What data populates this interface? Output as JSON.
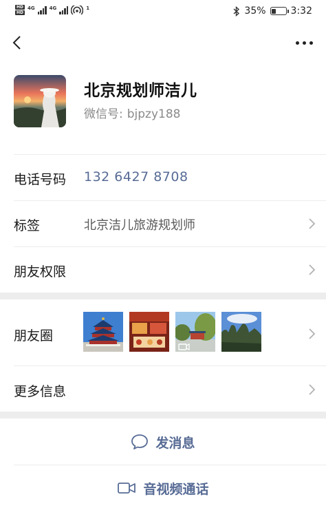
{
  "status_bar": {
    "hd1": "HD",
    "hd2": "HD",
    "net1": "4G",
    "net2": "4G",
    "hotspot_count": "1",
    "battery_percent": "35%",
    "battery_level": 0.35,
    "time": "3:32"
  },
  "profile": {
    "name": "北京规划师洁儿",
    "wechat_id_label": "微信号:",
    "wechat_id": "bjpzy188"
  },
  "rows": {
    "phone": {
      "label": "电话号码",
      "value": "132 6427 8708"
    },
    "tags": {
      "label": "标签",
      "value": "北京洁儿旅游规划师"
    },
    "permissions": {
      "label": "朋友权限"
    },
    "moments": {
      "label": "朋友圈"
    },
    "more_info": {
      "label": "更多信息"
    }
  },
  "actions": {
    "send_message": "发消息",
    "av_call": "音视频通话"
  },
  "colors": {
    "link_blue": "#576b95",
    "separator_gray": "#ededed",
    "secondary_text": "#8a8a8a"
  }
}
